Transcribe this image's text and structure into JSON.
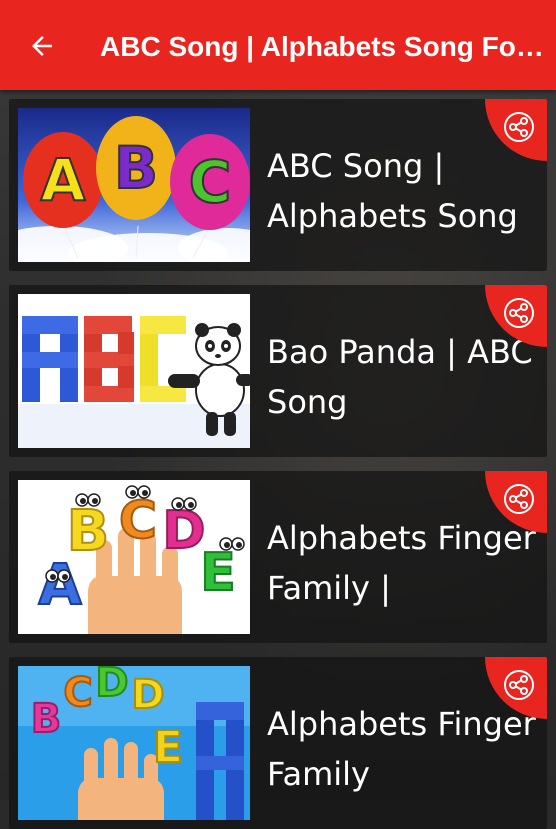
{
  "appbar": {
    "title": "ABC Song | Alphabets Song For Kids",
    "back_icon": "arrow-back-icon",
    "color": "#e8261f"
  },
  "videos": [
    {
      "title": "ABC Song | Alphabets Song",
      "thumbnail": "abc-balloons",
      "share_icon": "share-icon"
    },
    {
      "title": "Bao Panda | ABC Song",
      "thumbnail": "bao-panda-blocks",
      "share_icon": "share-icon"
    },
    {
      "title": "Alphabets Finger Family |",
      "thumbnail": "finger-family-letters",
      "share_icon": "share-icon"
    },
    {
      "title": "Alphabets Finger Family",
      "thumbnail": "finger-family-blocks",
      "share_icon": "share-icon"
    }
  ]
}
